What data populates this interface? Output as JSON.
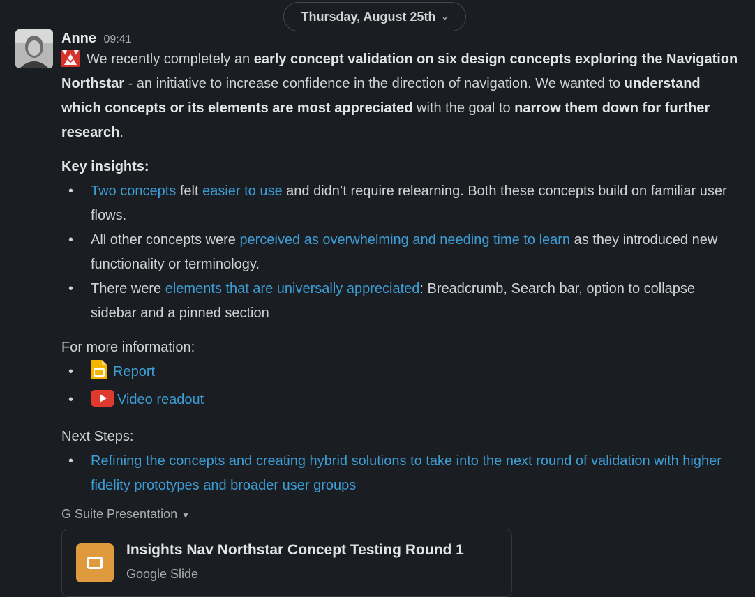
{
  "date_divider": {
    "label": "Thursday, August 25th"
  },
  "message": {
    "author": "Anne",
    "time": "09:41",
    "intro": {
      "t1": "We recently completely an ",
      "b1": "early concept validation on six design concepts exploring the Navigation Northstar",
      "t2": " - an initiative to increase confidence in the direction of navigation. We wanted to ",
      "b2": "understand which concepts or its elements are most appreciated",
      "t3": " with the goal to ",
      "b3": "narrow them down for further research",
      "t4": "."
    },
    "key_insights": {
      "title": "Key insights:",
      "items": [
        {
          "link1": "Two concepts",
          "t1": " felt ",
          "link2": "easier to use",
          "t2": " and didn’t require relearning. Both these concepts build on familiar user flows."
        },
        {
          "t1": "All other concepts were ",
          "link1": "perceived as overwhelming and needing time to learn",
          "t2": " as they introduced new functionality or terminology."
        },
        {
          "t1": "There were ",
          "link1": "elements that are universally appreciated",
          "t2": ": Breadcrumb, Search bar, option to collapse sidebar and a pinned section"
        }
      ]
    },
    "more_info": {
      "title": "For more information:",
      "items": [
        {
          "icon": "google-slides-icon",
          "label": "Report"
        },
        {
          "icon": "youtube-icon",
          "label": "Video readout"
        }
      ]
    },
    "next_steps": {
      "title": "Next Steps:",
      "items": [
        "Refining the concepts and creating hybrid solutions to take into the next round of validation with higher fidelity prototypes and broader user groups"
      ]
    },
    "attachment": {
      "section_label": "G Suite Presentation",
      "title": "Insights Nav Northstar Concept Testing Round 1",
      "subtitle": "Google Slide",
      "icon": "google-slides-icon"
    }
  },
  "colors": {
    "background": "#1a1d21",
    "link": "#3d9ed6",
    "slides": "#e09a3e",
    "youtube": "#e03a2f"
  }
}
